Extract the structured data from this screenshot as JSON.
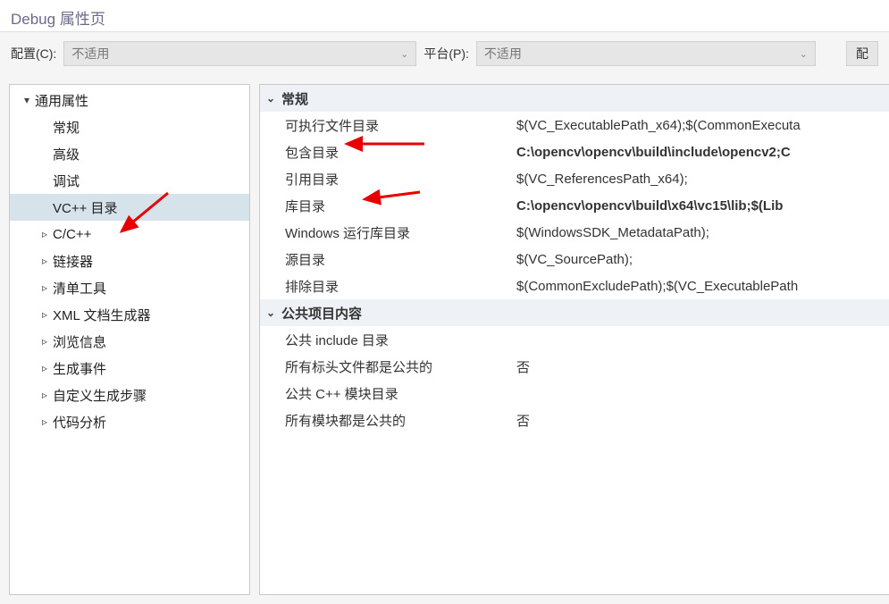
{
  "title": "Debug 属性页",
  "toolbar": {
    "config_label": "配置(C):",
    "config_value": "不适用",
    "platform_label": "平台(P):",
    "platform_value": "不适用",
    "button_fragment": "配"
  },
  "sidebar": {
    "items": [
      {
        "label": "通用属性",
        "expander": "down",
        "indent": 0,
        "selected": false
      },
      {
        "label": "常规",
        "expander": "none",
        "indent": 1,
        "selected": false
      },
      {
        "label": "高级",
        "expander": "none",
        "indent": 1,
        "selected": false
      },
      {
        "label": "调试",
        "expander": "none",
        "indent": 1,
        "selected": false
      },
      {
        "label": "VC++ 目录",
        "expander": "none",
        "indent": 1,
        "selected": true
      },
      {
        "label": "C/C++",
        "expander": "right",
        "indent": 1,
        "selected": false
      },
      {
        "label": "链接器",
        "expander": "right",
        "indent": 1,
        "selected": false
      },
      {
        "label": "清单工具",
        "expander": "right",
        "indent": 1,
        "selected": false
      },
      {
        "label": "XML 文档生成器",
        "expander": "right",
        "indent": 1,
        "selected": false
      },
      {
        "label": "浏览信息",
        "expander": "right",
        "indent": 1,
        "selected": false
      },
      {
        "label": "生成事件",
        "expander": "right",
        "indent": 1,
        "selected": false
      },
      {
        "label": "自定义生成步骤",
        "expander": "right",
        "indent": 1,
        "selected": false
      },
      {
        "label": "代码分析",
        "expander": "right",
        "indent": 1,
        "selected": false
      }
    ]
  },
  "grid": {
    "section1_header": "常规",
    "section1_rows": [
      {
        "key": "可执行文件目录",
        "value": "$(VC_ExecutablePath_x64);$(CommonExecuta",
        "bold": false
      },
      {
        "key": "包含目录",
        "value": "C:\\opencv\\opencv\\build\\include\\opencv2;C",
        "bold": true
      },
      {
        "key": "引用目录",
        "value": "$(VC_ReferencesPath_x64);",
        "bold": false
      },
      {
        "key": "库目录",
        "value": "C:\\opencv\\opencv\\build\\x64\\vc15\\lib;$(Lib",
        "bold": true
      },
      {
        "key": "Windows 运行库目录",
        "value": "$(WindowsSDK_MetadataPath);",
        "bold": false
      },
      {
        "key": "源目录",
        "value": "$(VC_SourcePath);",
        "bold": false
      },
      {
        "key": "排除目录",
        "value": "$(CommonExcludePath);$(VC_ExecutablePath",
        "bold": false
      }
    ],
    "section2_header": "公共项目内容",
    "section2_rows": [
      {
        "key": "公共 include 目录",
        "value": ""
      },
      {
        "key": "所有标头文件都是公共的",
        "value": "否"
      },
      {
        "key": "公共 C++ 模块目录",
        "value": ""
      },
      {
        "key": "所有模块都是公共的",
        "value": "否"
      }
    ]
  },
  "icons": {
    "tri_down": "▾",
    "tri_right": "▹",
    "chev_down": "⌄"
  }
}
